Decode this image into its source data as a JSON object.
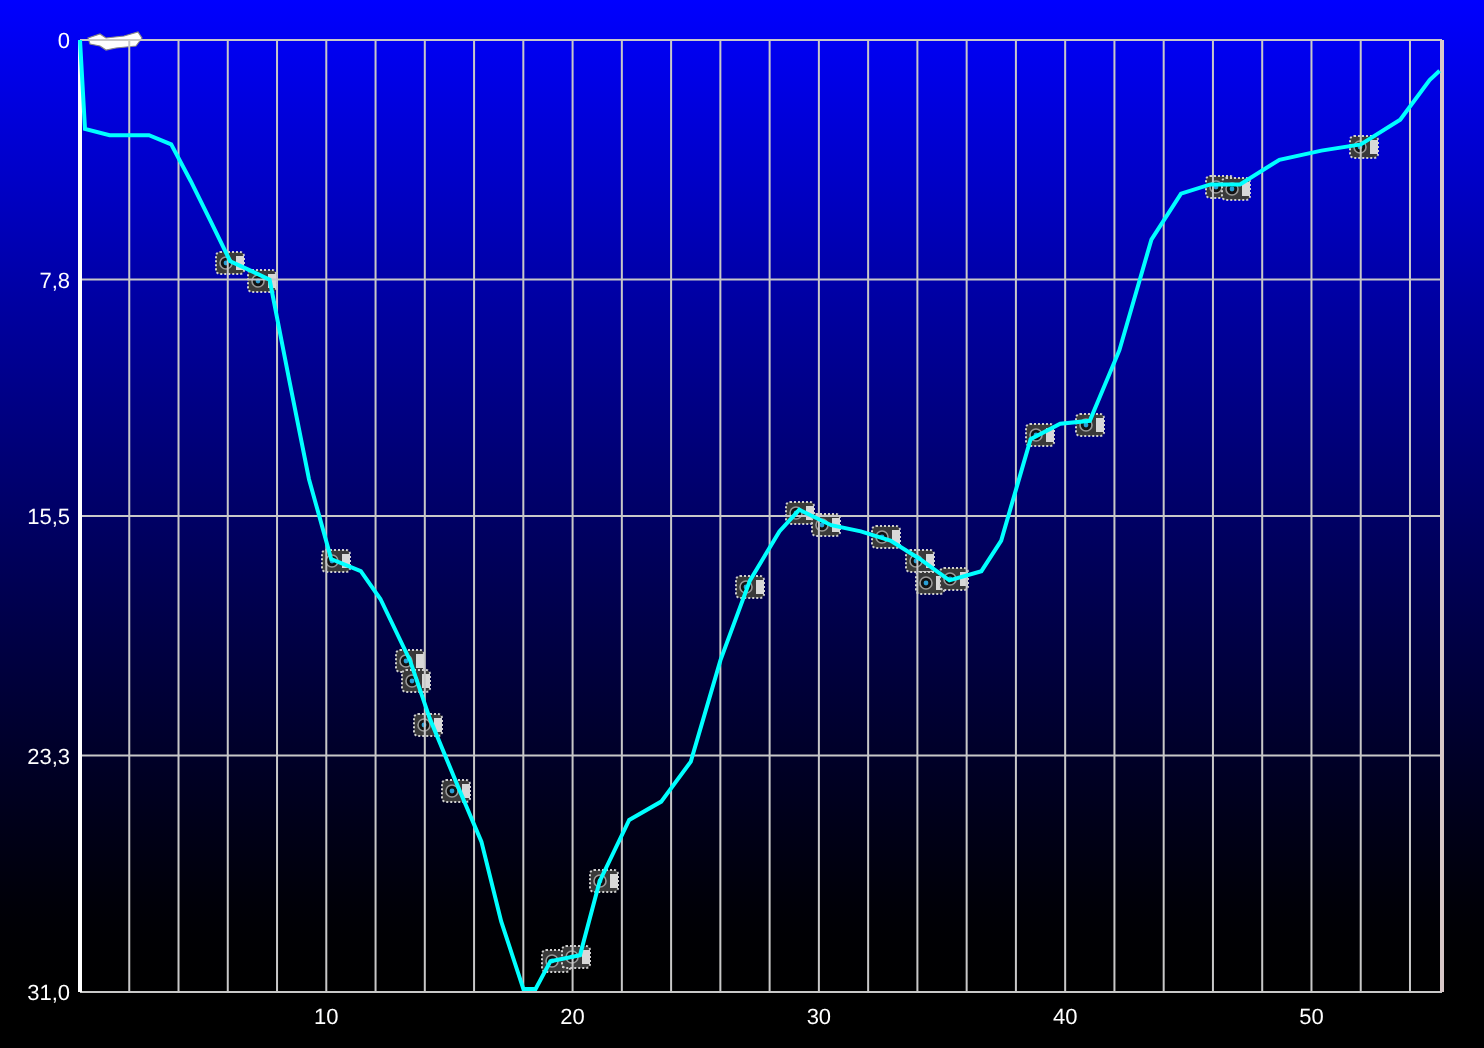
{
  "chart_data": {
    "type": "line",
    "grid": true,
    "xlim": [
      0,
      55.3
    ],
    "ylim": [
      31,
      0
    ],
    "xticks": [
      10,
      20,
      30,
      40,
      50
    ],
    "yticks": [
      {
        "value": 0,
        "label": "0"
      },
      {
        "value": 7.8,
        "label": "7,8"
      },
      {
        "value": 15.5,
        "label": "15,5"
      },
      {
        "value": 23.3,
        "label": "23,3"
      },
      {
        "value": 31,
        "label": "31,0"
      }
    ],
    "x": [
      0,
      0.2,
      1.2,
      2.8,
      3.7,
      4.5,
      5.3,
      6.1,
      6.9,
      7.7,
      8.5,
      9.3,
      10.2,
      11.4,
      12.2,
      13.4,
      14.2,
      15.4,
      16.3,
      17.1,
      18.0,
      18.5,
      19.1,
      20.3,
      21.1,
      22.3,
      23.6,
      24.8,
      26.0,
      27.2,
      28.4,
      29.2,
      30.5,
      31.7,
      32.9,
      34.1,
      35.3,
      36.6,
      37.4,
      38.6,
      39.8,
      41.0,
      42.2,
      43.5,
      44.7,
      45.9,
      47.1,
      48.7,
      50.4,
      52.0,
      53.6,
      54.8,
      55.2
    ],
    "series": [
      {
        "color": "#00ffff",
        "values": [
          0,
          2.9,
          3.1,
          3.1,
          3.4,
          4.6,
          5.9,
          7.2,
          7.5,
          7.8,
          11.1,
          14.3,
          16.9,
          17.3,
          18.2,
          20.2,
          22.1,
          24.4,
          26.1,
          28.7,
          30.9,
          30.9,
          30.0,
          29.8,
          27.4,
          25.4,
          24.8,
          23.5,
          20.2,
          17.6,
          16.0,
          15.3,
          15.8,
          16.0,
          16.3,
          16.9,
          17.6,
          17.3,
          16.3,
          13.0,
          12.5,
          12.4,
          10.1,
          6.5,
          5.0,
          4.7,
          4.7,
          3.9,
          3.6,
          3.4,
          2.6,
          1.3,
          1.0
        ]
      }
    ]
  }
}
